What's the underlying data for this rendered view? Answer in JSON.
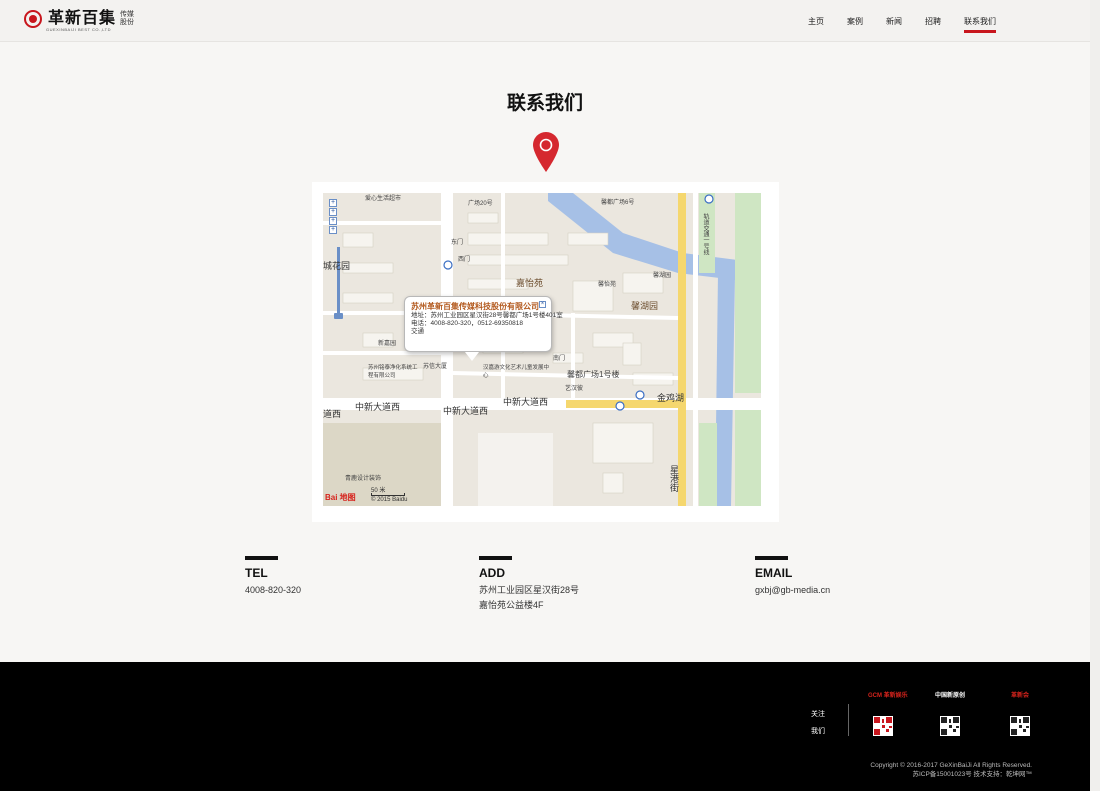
{
  "header": {
    "logo_text": "革新百集",
    "logo_sub_1": "传媒",
    "logo_sub_2": "股份",
    "logo_en": "GUEXINBAIJI BEST CO.,LTD",
    "nav": [
      {
        "label": "主页"
      },
      {
        "label": "案例"
      },
      {
        "label": "新闻"
      },
      {
        "label": "招聘"
      },
      {
        "label": "联系我们",
        "active": true
      }
    ]
  },
  "page_title": "联系我们",
  "map": {
    "info_title": "苏州革新百集传媒科技股份有限公司",
    "info_address": "地址：苏州工业园区星汉街28号馨都广场1号楼401室",
    "info_phone": "电话：4008-820-320，0512-69350818",
    "info_transit": "交通",
    "labels": {
      "jiayiyuan": "嘉怡苑",
      "xinhuyuan": "馨湖园",
      "zhongxin_1": "中新大道西",
      "zhongxin_2": "中新大道西",
      "zhongxin_3": "中新大道西",
      "zhongxin_4": "道西",
      "jinjihu": "金鸡湖",
      "xindu": "馨都广场1号楼",
      "xinggang": "星港街",
      "guidao": "轨道交通一号线",
      "huacheng": "城花园",
      "xinjiayuan": "新嘉园",
      "xiaolupu": "苏信大厦",
      "dongmen": "东门",
      "ximen": "西门",
      "nanmen": "南门",
      "wenchang": "汉嘉游文化艺术儿童发展中心",
      "qingyi": "青鹿设计装饰",
      "nanjing": "苏州铭泰净化系统工程有限公司",
      "aixin": "爱心生活超市",
      "pinglian": "艺汉彼",
      "gangxiu": "广场20号",
      "xindu_top": "馨都广场6号",
      "xinhu_small": "馨湖园",
      "xiangyi": "馨怡苑"
    },
    "scale": "50 米",
    "baidu_logo": "Bai 地图",
    "copyright": "© 2015 Baidu"
  },
  "contacts": [
    {
      "label": "TEL",
      "lines": [
        "4008-820-320"
      ]
    },
    {
      "label": "ADD",
      "lines": [
        "苏州工业园区星汉街28号",
        "嘉怡苑公益楼4F"
      ]
    },
    {
      "label": "EMAIL",
      "lines": [
        "gxbj@gb-media.cn"
      ]
    }
  ],
  "footer": {
    "follow_1": "关注",
    "follow_2": "我们",
    "social": [
      {
        "name": "革新娱乐",
        "logo_text": "GCM 革新娱乐",
        "color": "#d6231c"
      },
      {
        "name": "中国新原创",
        "logo_text": "中国新原创",
        "color": "#2b7fd0"
      },
      {
        "name": "革新会",
        "logo_text": "革新会",
        "color": "#d6231c"
      }
    ],
    "copyright": "Copyright © 2016-2017 GeXinBaiJi All Rights Reserved.",
    "icp": "苏ICP备15001023号   技术支持：乾坤网™"
  }
}
